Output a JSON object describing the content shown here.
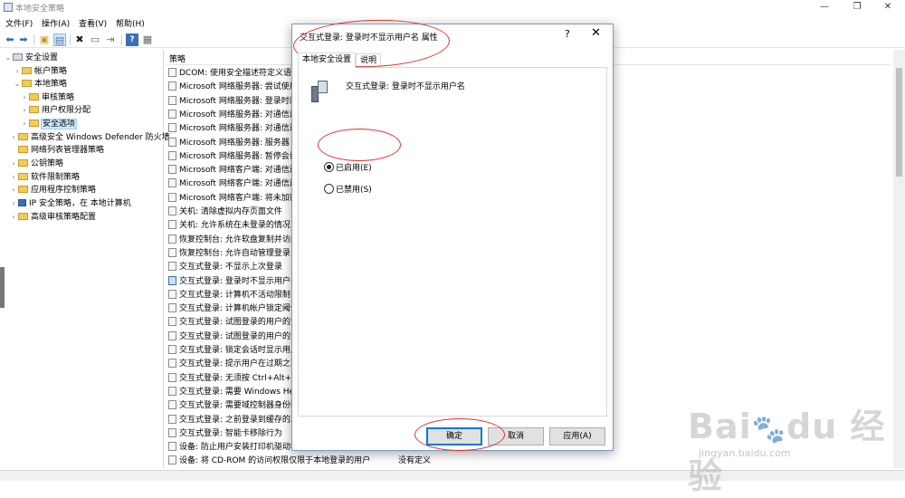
{
  "window": {
    "title": "本地安全策略"
  },
  "menu": [
    "文件(F)",
    "操作(A)",
    "查看(V)",
    "帮助(H)"
  ],
  "toolbar_icons": [
    "back-arrow-icon",
    "forward-arrow-icon",
    "up-folder-icon",
    "show-hide-tree-icon",
    "delete-icon",
    "properties-icon",
    "export-icon",
    "help-icon",
    "view-icon"
  ],
  "tree": {
    "items": [
      {
        "label": "安全设置",
        "level": 0,
        "expanded": true
      },
      {
        "label": "帐户策略",
        "level": 1,
        "expanded": false
      },
      {
        "label": "本地策略",
        "level": 1,
        "expanded": true
      },
      {
        "label": "审核策略",
        "level": 2,
        "expanded": false
      },
      {
        "label": "用户权限分配",
        "level": 2,
        "expanded": false
      },
      {
        "label": "安全选项",
        "level": 2,
        "expanded": false,
        "selected": true
      },
      {
        "label": "高级安全 Windows Defender 防火墙",
        "level": 1,
        "expanded": false
      },
      {
        "label": "网络列表管理器策略",
        "level": 1,
        "expanded": false
      },
      {
        "label": "公钥策略",
        "level": 1,
        "expanded": false
      },
      {
        "label": "软件限制策略",
        "level": 1,
        "expanded": false
      },
      {
        "label": "应用程序控制策略",
        "level": 1,
        "expanded": false
      },
      {
        "label": "IP 安全策略，在 本地计算机",
        "level": 1,
        "expanded": false
      },
      {
        "label": "高级审核策略配置",
        "level": 1,
        "expanded": false
      }
    ]
  },
  "list": {
    "header": "策略",
    "rows": [
      "DCOM: 使用安全描述符定义语",
      "Microsoft 网络服务器: 尝试使用",
      "Microsoft 网络服务器: 登录时间",
      "Microsoft 网络服务器: 对通信进",
      "Microsoft 网络服务器: 对通信进",
      "Microsoft 网络服务器: 服务器 S",
      "Microsoft 网络服务器: 暂停会话",
      "Microsoft 网络客户端: 对通信进",
      "Microsoft 网络客户端: 对通信进",
      "Microsoft 网络客户端: 将未加密",
      "关机: 清除虚拟内存页面文件",
      "关机: 允许系统在未登录的情况下",
      "恢复控制台: 允许软盘复制并访问",
      "恢复控制台: 允许自动管理登录",
      "交互式登录: 不显示上次登录",
      "交互式登录: 登录时不显示用户名",
      "交互式登录: 计算机不活动限制",
      "交互式登录: 计算机帐户锁定阈值",
      "交互式登录: 试图登录的用户的消",
      "交互式登录: 试图登录的用户的消",
      "交互式登录: 锁定会话时显示用户",
      "交互式登录: 提示用户在过期之前",
      "交互式登录: 无须按 Ctrl+Alt+D",
      "交互式登录: 需要 Windows Hel",
      "交互式登录: 需要域控制器身份验",
      "交互式登录: 之前登录到缓存的次",
      "交互式登录: 智能卡移除行为",
      "设备: 防止用户安装打印机驱动程",
      "设备: 将 CD-ROM 的访问权限仅限于本地登录的用户"
    ],
    "last_row_value": "没有定义"
  },
  "dialog": {
    "title": "交互式登录: 登录时不显示用户名 属性",
    "help_glyph": "?",
    "close_glyph": "✕",
    "tabs": [
      "本地安全设置",
      "说明"
    ],
    "policy_name": "交互式登录: 登录时不显示用户名",
    "options": [
      {
        "label": "已启用(E)",
        "checked": true
      },
      {
        "label": "已禁用(S)",
        "checked": false
      }
    ],
    "buttons": {
      "ok": "确定",
      "cancel": "取消",
      "apply": "应用(A)"
    }
  },
  "watermark": {
    "logo": "Bai du 经验",
    "url": "jingyan.baidu.com"
  },
  "colors": {
    "annotation": "#e03030",
    "selection": "#cce8ff",
    "folder": "#f0cc5a",
    "dialog_border": "#7a9cc6"
  }
}
